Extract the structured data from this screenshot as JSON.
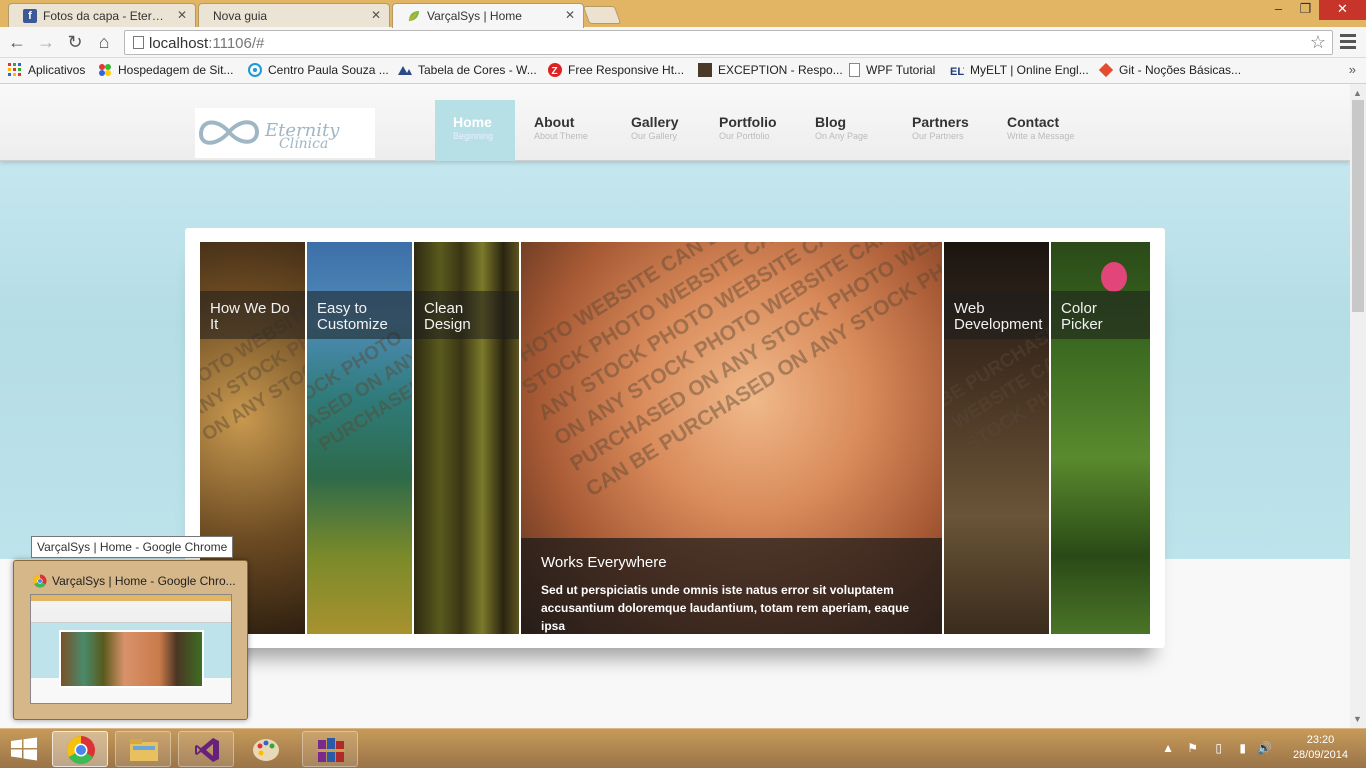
{
  "browser": {
    "tabs": [
      {
        "title": "Fotos da capa - Eternity Cl",
        "icon": "facebook-icon"
      },
      {
        "title": "Nova guia",
        "icon": "none"
      },
      {
        "title": "VarçalSys | Home",
        "icon": "leaf-icon",
        "active": true
      }
    ],
    "url_host": "localhost",
    "url_rest": ":11106/#",
    "bookmarks": [
      {
        "label": "Aplicativos",
        "icon": "apps-grid-icon"
      },
      {
        "label": "Hospedagem de Sit...",
        "icon": "hosting-icon"
      },
      {
        "label": "Centro Paula Souza ...",
        "icon": "cps-icon"
      },
      {
        "label": "Tabela de Cores - W...",
        "icon": "colors-icon"
      },
      {
        "label": "Free Responsive Ht...",
        "icon": "z-icon"
      },
      {
        "label": "EXCEPTION - Respo...",
        "icon": "exception-icon"
      },
      {
        "label": "WPF Tutorial",
        "icon": "page-icon"
      },
      {
        "label": "MyELT | Online Engl...",
        "icon": "elt-icon"
      },
      {
        "label": "Git - Noções Básicas...",
        "icon": "git-icon"
      }
    ]
  },
  "site": {
    "logo_text": "Eternity Clínica",
    "nav": [
      {
        "label": "Home",
        "sub": "Beginning",
        "active": true
      },
      {
        "label": "About",
        "sub": "About Theme"
      },
      {
        "label": "Gallery",
        "sub": "Our Gallery"
      },
      {
        "label": "Portfolio",
        "sub": "Our Portfolio"
      },
      {
        "label": "Blog",
        "sub": "On Any Page"
      },
      {
        "label": "Partners",
        "sub": "Our Partners"
      },
      {
        "label": "Contact",
        "sub": "Write a Message"
      }
    ],
    "slider": {
      "panels": [
        {
          "caption": "How We Do It"
        },
        {
          "caption": "Easy to Customize"
        },
        {
          "caption": "Clean Design"
        },
        {
          "caption": "Works Everywhere",
          "text": "Sed ut perspiciatis unde omnis iste natus error sit voluptatem accusantium doloremque laudantium, totam rem aperiam, eaque ipsa"
        },
        {
          "caption": "Web Development"
        },
        {
          "caption": "Color Picker"
        }
      ],
      "watermark": "CAN BE PURCHASED ON ANY STOCK PHOTO WEBSITE"
    }
  },
  "taskbar": {
    "tooltip": "VarçalSys | Home - Google Chrome",
    "preview_title": "VarçalSys | Home - Google Chro...",
    "time": "23:20",
    "date": "28/09/2014"
  },
  "colors": {
    "tab_strip": "#e2b565",
    "page_accent": "#b6dfe6",
    "taskbar": "#b08450"
  }
}
